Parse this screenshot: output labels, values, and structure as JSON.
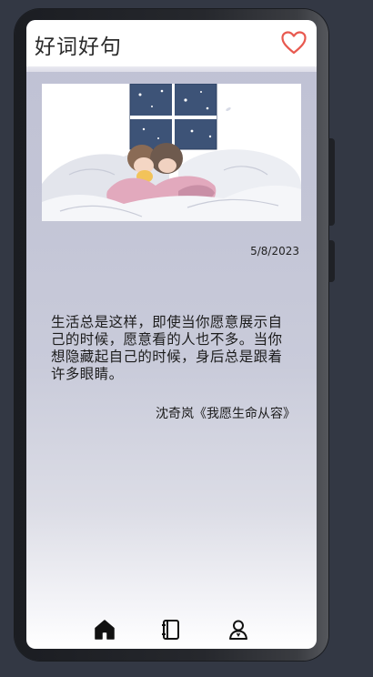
{
  "app": {
    "title": "好词好句"
  },
  "card": {
    "date": "5/8/2023",
    "quote": "生活总是这样，即使当你愿意展示自己的时候，愿意看的人也不多。当你想隐藏起自己的时候，身后总是跟着许多眼睛。",
    "author": "沈奇岚《我愿生命从容》"
  },
  "icons": {
    "favorite": "heart-outline-icon",
    "home": "home-icon",
    "notebook": "notebook-icon",
    "profile": "user-icon"
  },
  "colors": {
    "accent": "#e8594f",
    "text": "#1c1c1c",
    "window": "#3d5377"
  }
}
